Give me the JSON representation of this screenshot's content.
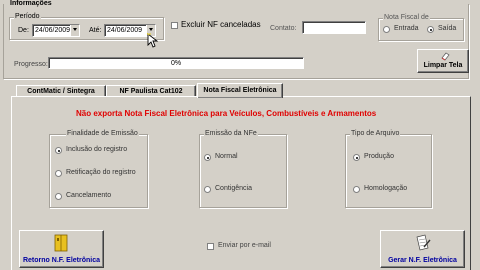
{
  "info": {
    "title": "Informações",
    "periodo_title": "Período",
    "de_label": "De:",
    "de_value": "24/06/2009",
    "ate_label": "Até:",
    "ate_value": "24/06/2009",
    "excluir_label": "Excluir NF canceladas",
    "contato_label": "Contato:",
    "contato_value": ""
  },
  "nota_fiscal": {
    "title": "Nota Fiscal de",
    "entrada": "Entrada",
    "saida": "Saída",
    "selected": "Saída"
  },
  "progresso": {
    "label": "Progresso:",
    "text": "0%",
    "fraction": 0
  },
  "limpar_label": "Limpar Tela",
  "tabs": [
    {
      "label": "ContMatic / Sintegra"
    },
    {
      "label": "NF Paulista Cat102"
    },
    {
      "label": "Nota Fiscal Eletrônica"
    }
  ],
  "warning": "Não exporta Nota Fiscal Eletrônica para Veículos, Combustíveis e Armamentos",
  "finalidade": {
    "title": "Finalidade de Emissão",
    "options": [
      "Inclusão do registro",
      "Retificação do registro",
      "Cancelamento"
    ],
    "selected": "Inclusão do registro"
  },
  "emissao": {
    "title": "Emissão da NFe",
    "options": [
      "Normal",
      "Contigência"
    ],
    "selected": "Normal"
  },
  "tipo_arquivo": {
    "title": "Tipo de Arquivo",
    "options": [
      "Produção",
      "Homologação"
    ],
    "selected": "Produção"
  },
  "enviar_email_label": "Enviar por e-mail",
  "retorno_label": "Retorno N.F. Eletrônica",
  "gerar_label": "Gerar N.F. Eletrônica",
  "colors": {
    "warning": "#e00000",
    "accent": "#0000c0",
    "folder": "#e8c020"
  }
}
